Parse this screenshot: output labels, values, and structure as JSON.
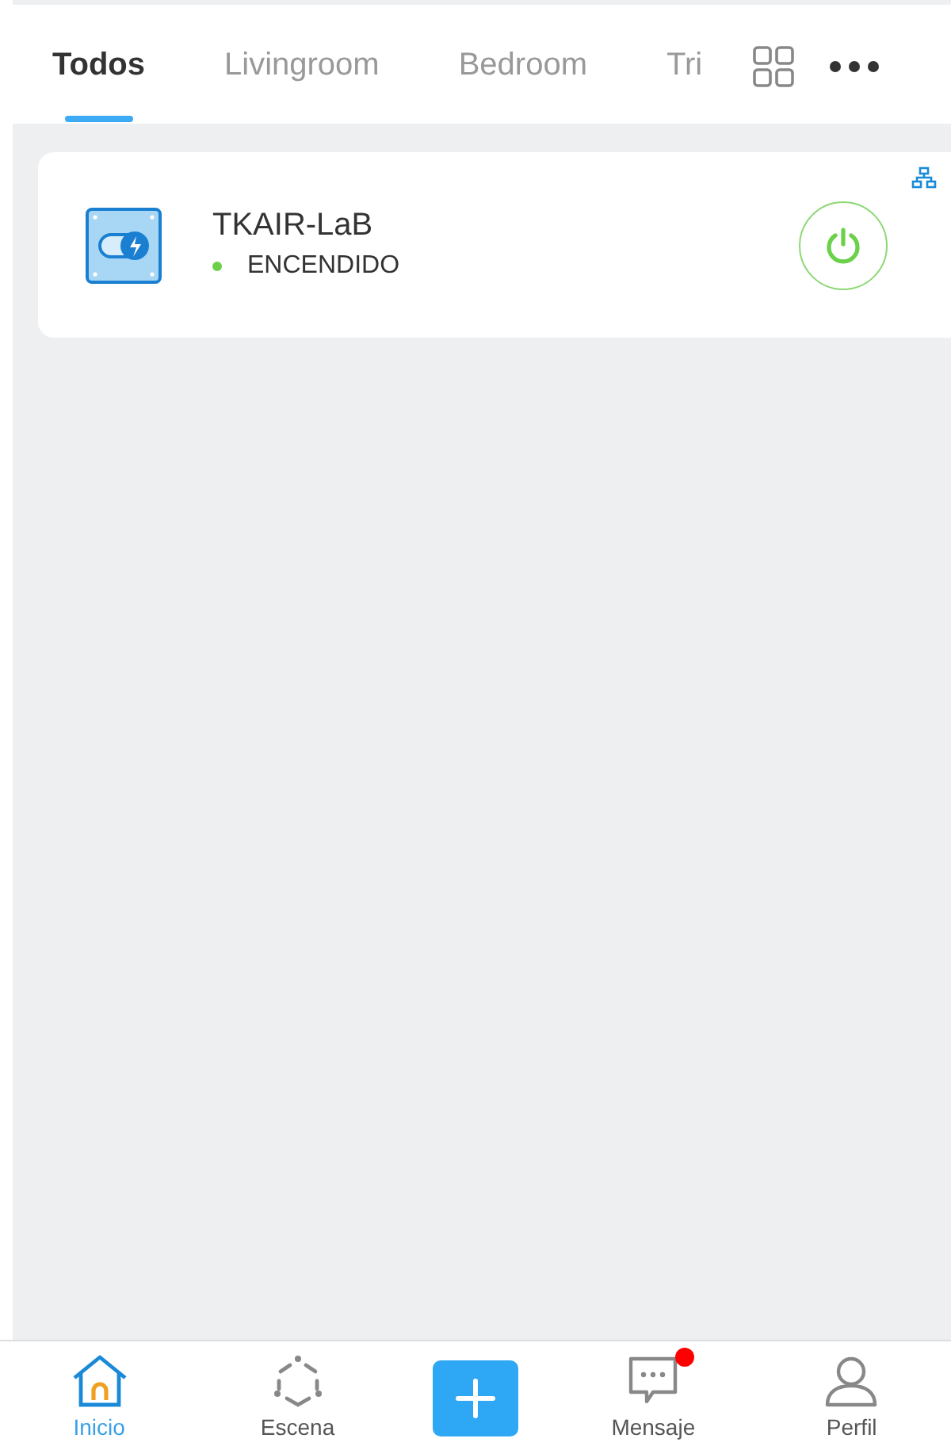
{
  "tabs": [
    {
      "label": "Todos",
      "selected": true
    },
    {
      "label": "Livingroom",
      "selected": false
    },
    {
      "label": "Bedroom",
      "selected": false
    },
    {
      "label": "Tri",
      "selected": false
    }
  ],
  "devices": [
    {
      "name": "TKAIR-LaB",
      "status": "ENCENDIDO",
      "on": true
    }
  ],
  "nav": [
    {
      "kind": "home",
      "label": "Inicio",
      "selected": true,
      "badge": false
    },
    {
      "kind": "scene",
      "label": "Escena",
      "selected": false,
      "badge": false
    },
    {
      "kind": "add"
    },
    {
      "kind": "message",
      "label": "Mensaje",
      "selected": false,
      "badge": true
    },
    {
      "kind": "profile",
      "label": "Perfil",
      "selected": false,
      "badge": false
    }
  ]
}
